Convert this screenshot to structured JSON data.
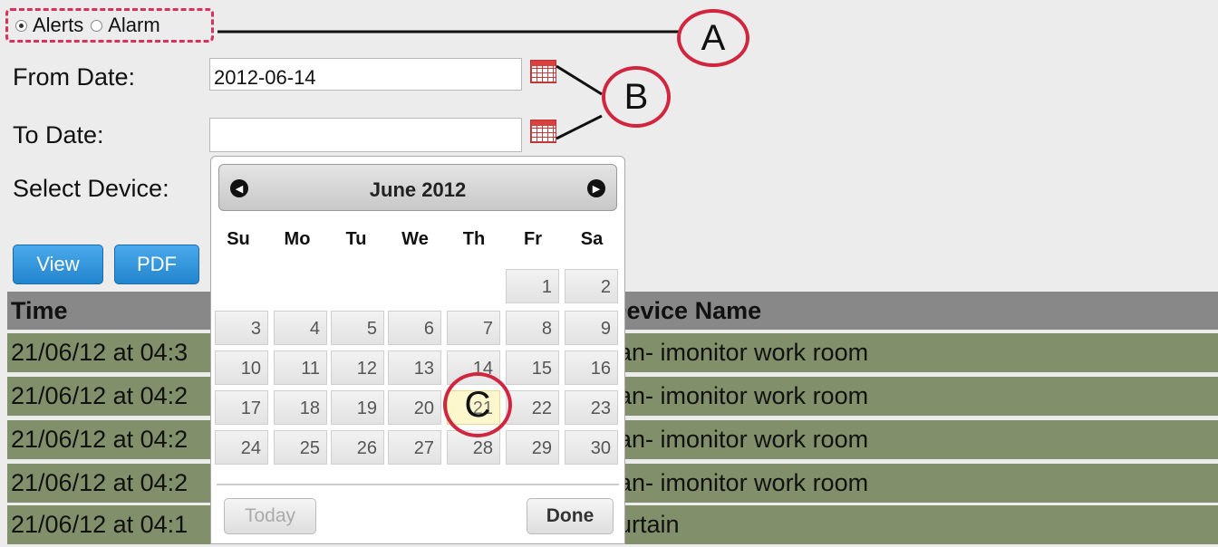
{
  "filter": {
    "alerts_label": "Alerts",
    "alarm_label": "Alarm",
    "selected": "Alerts"
  },
  "form": {
    "from_label": "From Date:",
    "from_value": "2012-06-14",
    "to_label": "To Date:",
    "to_value": "",
    "device_label": "Select Device:"
  },
  "actions": {
    "view_label": "View",
    "pdf_label": "PDF"
  },
  "table": {
    "headers": [
      "Time",
      "Device Name"
    ],
    "rows": [
      {
        "time": "21/06/12 at 04:3",
        "device": "an- imonitor work room"
      },
      {
        "time": "21/06/12 at 04:2",
        "device": "an- imonitor work room"
      },
      {
        "time": "21/06/12 at 04:2",
        "device": "an- imonitor work room"
      },
      {
        "time": "21/06/12 at 04:2",
        "device": "an- imonitor work room"
      },
      {
        "time": "21/06/12 at 04:1",
        "device": "urtain"
      }
    ]
  },
  "datepicker": {
    "month_label": "June 2012",
    "weekdays": [
      "Su",
      "Mo",
      "Tu",
      "We",
      "Th",
      "Fr",
      "Sa"
    ],
    "today_label": "Today",
    "done_label": "Done",
    "highlighted_day": "21"
  },
  "callouts": {
    "a": "A",
    "b": "B",
    "c": "C"
  },
  "colors": {
    "accent": "#d1263f",
    "button_blue": "#2f93dc",
    "row_green": "#818f6a",
    "header_gray": "#888888"
  }
}
